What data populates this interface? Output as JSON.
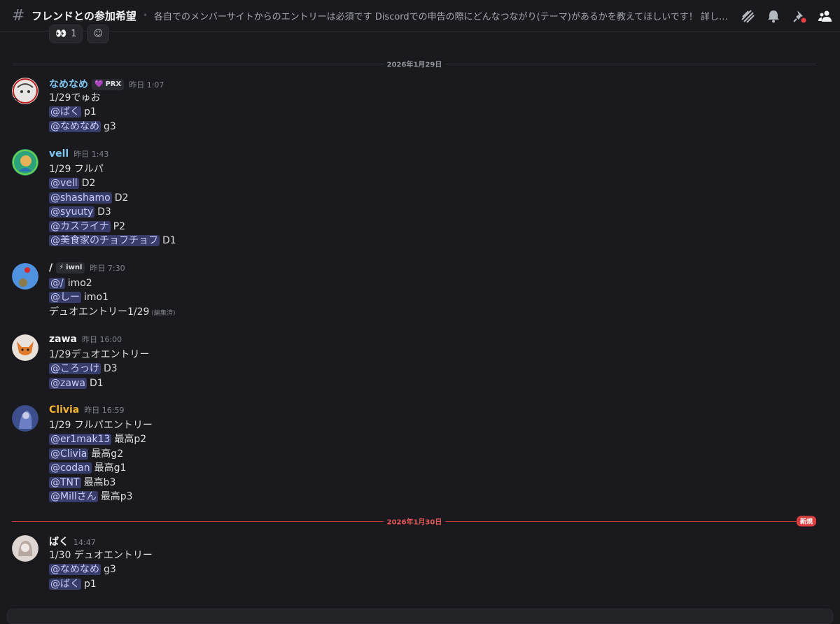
{
  "header": {
    "channel_name": "フレンドとの参加希望",
    "topic": "各自でのメンバーサイトからのエントリーは必須です Discordでの申告の際にどんなつながり(テーマ)があるかを教えてほしいです！ 詳しい...",
    "icons": [
      "threads-icon",
      "bell-icon",
      "pin-icon",
      "members-icon"
    ]
  },
  "reactions": [
    {
      "emoji": "👀",
      "count": "1"
    },
    {
      "emoji": "☺",
      "count": ""
    }
  ],
  "dividers": {
    "d1": "2026年1月29日",
    "d2": "2026年1月30日",
    "new_badge": "新規"
  },
  "messages": [
    {
      "username": "なめなめ",
      "color": "#7fc5f2",
      "tag": "PRX",
      "tag_icon": "💜",
      "timestamp": "昨日 1:07",
      "lines": [
        {
          "text": "1/29でゅお"
        },
        {
          "mention": "@ばく",
          "text": "p1"
        },
        {
          "mention": "@なめなめ",
          "text": "g3"
        }
      ]
    },
    {
      "username": "vell",
      "color": "#7fc5f2",
      "timestamp": "昨日 1:43",
      "lines": [
        {
          "text": "1/29 フルパ"
        },
        {
          "mention": "@vell",
          "text": "D2"
        },
        {
          "mention": "@shashamo",
          "text": "D2"
        },
        {
          "mention": "@syuuty",
          "text": "D3"
        },
        {
          "mention": "@カスライナ",
          "text": "P2"
        },
        {
          "mention": "@美食家のチョフチョフ",
          "text": "D1"
        }
      ]
    },
    {
      "username": "/",
      "color": "#f2f3f5",
      "tag": "iwnl",
      "tag_icon": "⚡",
      "timestamp": "昨日 7:30",
      "lines": [
        {
          "mention": "@/",
          "text": "imo2"
        },
        {
          "mention": "@しー",
          "text": "imo1"
        },
        {
          "text": "デュオエントリー1/29",
          "edited": "(編集済)"
        }
      ]
    },
    {
      "username": "zawa",
      "color": "#f2f3f5",
      "timestamp": "昨日 16:00",
      "lines": [
        {
          "text": "1/29デュオエントリー"
        },
        {
          "mention": "@ころっけ",
          "text": "D3"
        },
        {
          "mention": "@zawa",
          "text": "D1"
        }
      ]
    },
    {
      "username": "Clivia",
      "color": "#f0b232",
      "timestamp": "昨日 16:59",
      "lines": [
        {
          "text": "1/29 フルパエントリー"
        },
        {
          "mention": "@er1mak13",
          "text": "最高p2"
        },
        {
          "mention": "@Clivia",
          "text": "最高g2"
        },
        {
          "mention": "@codan",
          "text": "最高g1"
        },
        {
          "mention": "@TNT",
          "text": "最高b3"
        },
        {
          "mention": "@Millさん",
          "text": "最高p3"
        }
      ]
    },
    {
      "username": "ばく",
      "color": "#f2f3f5",
      "timestamp": "14:47",
      "lines": [
        {
          "text": "1/30 デュオエントリー"
        },
        {
          "mention": "@なめなめ",
          "text": "g3"
        },
        {
          "mention": "@ばく",
          "text": "p1"
        }
      ]
    }
  ]
}
